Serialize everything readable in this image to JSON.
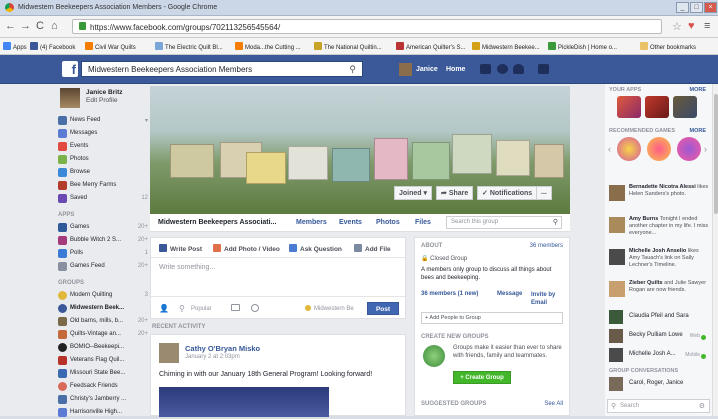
{
  "window": {
    "title": "Midwestern Beekeepers Association Members - Google Chrome"
  },
  "address": {
    "url": "https://www.facebook.com/groups/702113256545564/"
  },
  "bookmarks": {
    "apps": "Apps",
    "items": [
      "(4) Facebook",
      "Civil War Quilts",
      "The Electric Quilt Bl...",
      "Moda...the Cutting ...",
      "The National Quiltin...",
      "American Quilter's S...",
      "Midwestern Beekee...",
      "PickleDish | Home o..."
    ],
    "other": "Other bookmarks"
  },
  "fb": {
    "search_value": "Midwestern Beekeepers Association Members",
    "user": "Janice",
    "home": "Home"
  },
  "left": {
    "profile_name": "Janice Britz",
    "edit_profile": "Edit Profile",
    "nav": [
      {
        "label": "News Feed",
        "count": ""
      },
      {
        "label": "Messages",
        "count": ""
      },
      {
        "label": "Events",
        "count": ""
      },
      {
        "label": "Photos",
        "count": ""
      },
      {
        "label": "Browse",
        "count": ""
      },
      {
        "label": "Bee Merry Farms",
        "count": ""
      },
      {
        "label": "Saved",
        "count": "12"
      }
    ],
    "apps_header": "APPS",
    "apps": [
      {
        "label": "Games",
        "count": "20+"
      },
      {
        "label": "Bubble Witch 2 S...",
        "count": "20+"
      },
      {
        "label": "Polls",
        "count": "1"
      },
      {
        "label": "Games Feed",
        "count": "20+"
      }
    ],
    "groups_header": "GROUPS",
    "groups": [
      {
        "label": "Modern Quilting",
        "count": "3"
      },
      {
        "label": "Midwestern Beek...",
        "count": ""
      },
      {
        "label": "Old barns, mills, b...",
        "count": "20+"
      },
      {
        "label": "Quilts-Vintage an...",
        "count": "20+"
      },
      {
        "label": "BOMIO--Beekeepi...",
        "count": ""
      },
      {
        "label": "Veterans Flag Quil...",
        "count": ""
      },
      {
        "label": "Missouri State Bee...",
        "count": ""
      },
      {
        "label": "Feedsack Friends",
        "count": ""
      },
      {
        "label": "Christy's Jamberry ...",
        "count": ""
      },
      {
        "label": "Harrisonville High...",
        "count": ""
      }
    ]
  },
  "cover": {
    "joined": "Joined",
    "share": "Share",
    "notifications": "Notifications",
    "more": "..."
  },
  "tabs": {
    "group_name": "Midwestern Beekeepers Associati...",
    "items": [
      "Members",
      "Events",
      "Photos",
      "Files"
    ],
    "search_placeholder": "Search this group"
  },
  "composer": {
    "write_post": "Write Post",
    "add_photo": "Add Photo / Video",
    "ask_question": "Ask Question",
    "add_file": "Add File",
    "placeholder": "Write something...",
    "audience": "Popular",
    "group_tag": "Midwestern Be",
    "post": "Post"
  },
  "recent_activity": "RECENT ACTIVITY",
  "post": {
    "author": "Cathy O'Bryan Misko",
    "date": "January 2 at 2:03pm",
    "text": "Chiming in with our January 18th General Program! Looking forward!"
  },
  "about": {
    "header": "ABOUT",
    "members": "36 members",
    "closed": "Closed Group",
    "desc": "A members only group to discuss all things about bees and beekeeping.",
    "members_new": "36 members (1 new)",
    "message": "Message",
    "invite": "Invite by Email",
    "add_people_placeholder": "+ Add People to Group",
    "create_header": "CREATE NEW GROUPS",
    "create_desc": "Groups make it easier than ever to share with friends, family and teammates.",
    "create_button": "+ Create Group",
    "suggested_header": "SUGGESTED GROUPS",
    "see_all": "See All"
  },
  "right": {
    "your_apps": "YOUR APPS",
    "more": "MORE",
    "recommended": "RECOMMENDED GAMES",
    "ticker": [
      {
        "name": "Bernadette Nicotra Alessi",
        "text": "likes Helen Sanders's photo."
      },
      {
        "name": "Amy Burns",
        "text": "Tonight I ended another chapter in my life. I miss everyone..."
      },
      {
        "name": "Michelle Josh Anselio",
        "text": "likes Amy Tauach's link on Sally Lechner's Timeline."
      },
      {
        "name": "Zieber Quilts",
        "text": "and Julie Sawyer Rogan are now friends."
      }
    ],
    "chats": [
      {
        "name": "Claudia Pfeil and Sara",
        "status": ""
      },
      {
        "name": "Becky Pulliam Lowe",
        "status": "Web"
      },
      {
        "name": "Michelle Josh A...",
        "status": "Mobile"
      }
    ],
    "conv_header": "GROUP CONVERSATIONS",
    "conv": "Carol, Roger, Janice",
    "search_placeholder": "Search"
  },
  "colors": {
    "fb_blue": "#3b5998",
    "button_blue": "#4267b2",
    "green": "#42b72a"
  }
}
